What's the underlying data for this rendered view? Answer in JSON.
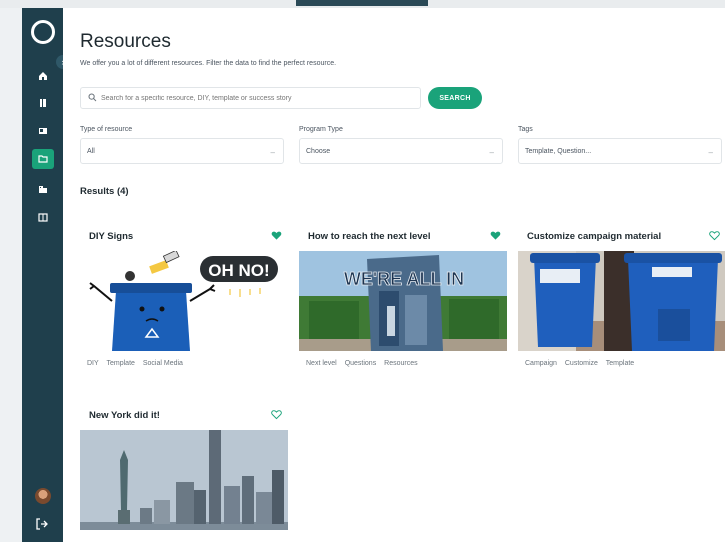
{
  "header": {
    "title": "Resources",
    "subtitle": "We offer you a lot of different resources. Filter the data to find the perfect resource."
  },
  "search": {
    "placeholder": "Search for a specific resource, DIY, template or success story",
    "button_label": "SEARCH"
  },
  "filters": [
    {
      "label": "Type of resource",
      "value": "All"
    },
    {
      "label": "Program Type",
      "value": "Choose"
    },
    {
      "label": "Tags",
      "value": "Template, Question..."
    }
  ],
  "results_label": "Results (4)",
  "cards": [
    {
      "title": "DIY Signs",
      "favorited": true,
      "tags": [
        "DIY",
        "Template",
        "Social Media"
      ],
      "image_text": "OH NO!"
    },
    {
      "title": "How to reach the next level",
      "favorited": true,
      "tags": [
        "Next level",
        "Questions",
        "Resources"
      ],
      "image_text": "WE'RE ALL IN"
    },
    {
      "title": "Customize campaign material",
      "favorited": false,
      "tags": [
        "Campaign",
        "Customize",
        "Template"
      ]
    },
    {
      "title": "New York did it!",
      "favorited": false,
      "tags": []
    }
  ],
  "sidebar": {
    "items": [
      "home-icon",
      "book-icon",
      "news-icon",
      "folder-icon",
      "building-icon",
      "book-open-icon"
    ],
    "active_index": 3
  },
  "colors": {
    "sidebar": "#1f3f4c",
    "accent": "#1aa37a",
    "recycle_blue": "#1b5fb8"
  }
}
